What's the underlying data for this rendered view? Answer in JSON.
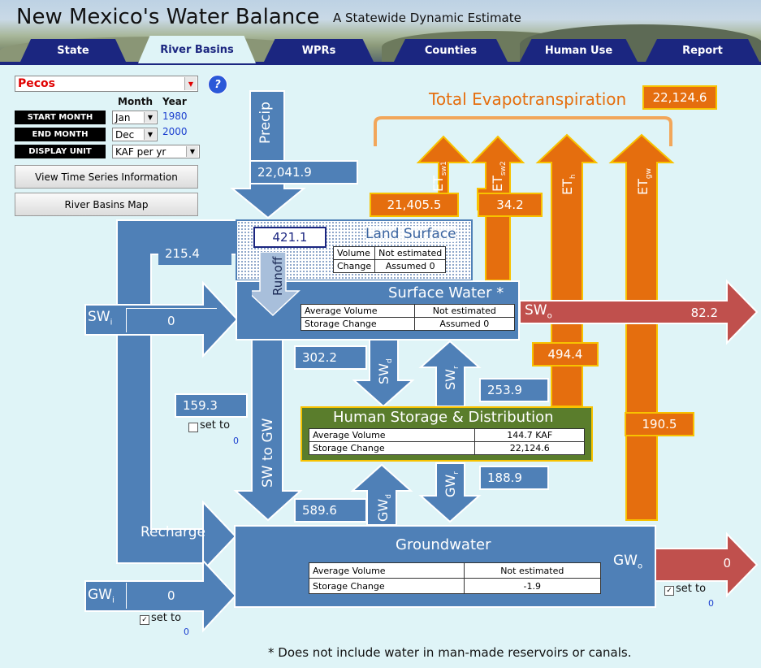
{
  "header": {
    "title": "New Mexico's Water Balance",
    "subtitle": "A Statewide Dynamic Estimate"
  },
  "tabs": [
    {
      "label": "State"
    },
    {
      "label": "River Basins"
    },
    {
      "label": "WPRs"
    },
    {
      "label": "Counties"
    },
    {
      "label": "Human Use"
    },
    {
      "label": "Report"
    }
  ],
  "controls": {
    "basin": "Pecos",
    "help": "?",
    "month_hdr": "Month",
    "year_hdr": "Year",
    "start_label": "START MONTH",
    "start_month": "Jan",
    "start_year": "1980",
    "end_label": "END MONTH",
    "end_month": "Dec",
    "end_year": "2000",
    "unit_label": "DISPLAY UNIT",
    "unit": "KAF per yr",
    "ts_button": "View Time Series Information",
    "map_button": "River Basins Map"
  },
  "colors": {
    "blue": "#4f80b7",
    "orange": "#e56e0e",
    "red": "#c0504d",
    "green": "#5a7d2c",
    "navy": "#1b2680"
  },
  "et": {
    "title": "Total Evapotranspiration",
    "total": "22,124.6",
    "sw1": "21,405.5",
    "sw2": "34.2",
    "h": "494.4",
    "gw": "190.5",
    "lab_et": "ET",
    "sub_sw1": "sw1",
    "sub_sw2": "sw2",
    "sub_h": "h",
    "sub_gw": "gw"
  },
  "precip": {
    "label": "Precip",
    "value": "22,041.9"
  },
  "land": {
    "title": "Land Surface",
    "runoff_label": "Runoff",
    "runoff": "421.1",
    "rows": [
      [
        "Volume",
        "Not estimated"
      ],
      [
        "Change",
        "Assumed 0"
      ]
    ]
  },
  "surface": {
    "title": "Surface Water *",
    "rows": [
      [
        "Average Volume",
        "Not estimated"
      ],
      [
        "Storage Change",
        "Assumed 0"
      ]
    ]
  },
  "swi": {
    "label": "SW",
    "sub": "i",
    "value": "0",
    "upper": "215.4"
  },
  "swo": {
    "label": "SW",
    "sub": "o",
    "value": "82.2"
  },
  "swd": {
    "label": "SW",
    "sub": "d",
    "value": "302.2"
  },
  "swr": {
    "label": "SW",
    "sub": "r",
    "value": "253.9"
  },
  "human": {
    "title": "Human Storage & Distribution",
    "rows": [
      [
        "Average Volume",
        "144.7 KAF"
      ],
      [
        "Storage Change",
        "22,124.6"
      ]
    ]
  },
  "sw_to_gw": {
    "label": "SW to GW",
    "value": "159.3",
    "set_to": "set to",
    "set_val": "0"
  },
  "gwd": {
    "label": "GW",
    "sub": "d",
    "value": "589.6"
  },
  "gwr": {
    "label": "GW",
    "sub": "r",
    "value": "188.9"
  },
  "ground": {
    "title": "Groundwater",
    "rows": [
      [
        "Average Volume",
        "Not estimated"
      ],
      [
        "Storage Change",
        "-1.9"
      ]
    ]
  },
  "recharge": {
    "label": "Recharge"
  },
  "gwi": {
    "label": "GW",
    "sub": "i",
    "value": "0",
    "set_to": "set to",
    "set_val": "0"
  },
  "gwo": {
    "label": "GW",
    "sub": "o",
    "value": "0",
    "set_to": "set to",
    "set_val": "0"
  },
  "footnote": "* Does not include water in man-made reservoirs or canals."
}
